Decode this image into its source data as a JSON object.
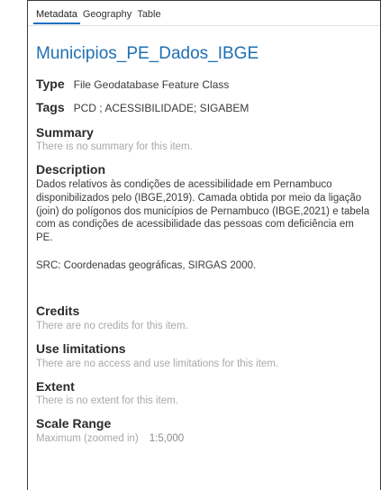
{
  "tabs": [
    {
      "label": "Metadata",
      "active": true
    },
    {
      "label": "Geography",
      "active": false
    },
    {
      "label": "Table",
      "active": false
    }
  ],
  "item": {
    "title": "Municipios_PE_Dados_IBGE",
    "type_label": "Type",
    "type_value": "File Geodatabase Feature Class",
    "tags_label": "Tags",
    "tags_value": "PCD ; ACESSIBILIDADE; SIGABEM"
  },
  "summary": {
    "heading": "Summary",
    "text": "There is no summary for this item."
  },
  "description": {
    "heading": "Description",
    "text": "Dados relativos às condições de acessibilidade em Pernambuco disponibilizados pelo (IBGE,2019).  Camada obtida por meio da ligação (join) do polígonos dos municípios de Pernambuco (IBGE,2021) e  tabela com as condições de acessibilidade das pessoas com deficiência em PE.",
    "src": "SRC: Coordenadas geográficas, SIRGAS 2000."
  },
  "credits": {
    "heading": "Credits",
    "text": "There are no credits for this item."
  },
  "use_limitations": {
    "heading": "Use limitations",
    "text": "There are no access and use limitations for this item."
  },
  "extent": {
    "heading": "Extent",
    "text": "There is no extent for this item."
  },
  "scale_range": {
    "heading": "Scale Range",
    "max_label": "Maximum (zoomed in)",
    "max_value": "1:5,000"
  },
  "colors": {
    "title": "#1f6fb2",
    "muted": "#a8a8a8",
    "active_tab": "#1e6fbf"
  }
}
